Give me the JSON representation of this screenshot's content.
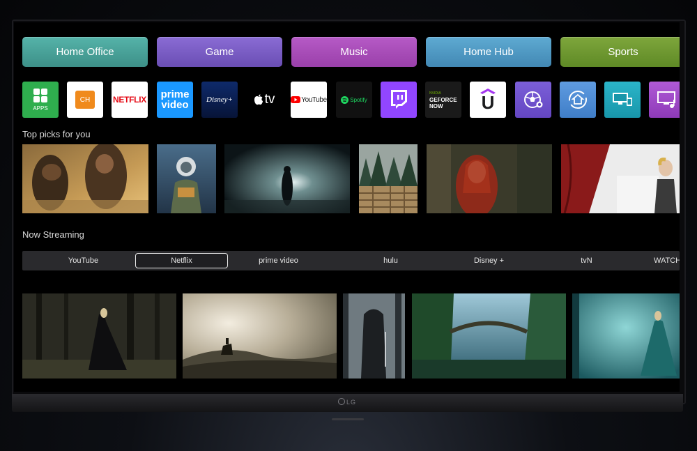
{
  "categories": [
    {
      "label": "Home Office",
      "color": "#4aa39a"
    },
    {
      "label": "Game",
      "color": "#7a5cc4"
    },
    {
      "label": "Music",
      "color": "#a84cb8"
    },
    {
      "label": "Home Hub",
      "color": "#4f9cc4"
    },
    {
      "label": "Sports",
      "color": "#6f9a2e"
    }
  ],
  "apps": [
    {
      "name": "apps",
      "label": "APPS"
    },
    {
      "name": "lg-channels",
      "label": "CH"
    },
    {
      "name": "netflix",
      "label": "NETFLIX"
    },
    {
      "name": "prime-video",
      "label_top": "prime",
      "label_bottom": "video"
    },
    {
      "name": "disney-plus",
      "label": "Disney+"
    },
    {
      "name": "apple-tv",
      "label": "tv"
    },
    {
      "name": "youtube",
      "label": "YouTube"
    },
    {
      "name": "spotify",
      "label": "Spotify"
    },
    {
      "name": "twitch",
      "label": ""
    },
    {
      "name": "geforce-now",
      "label_top": "NVIDIA",
      "label_mid": "GEFORCE",
      "label_bottom": "NOW"
    },
    {
      "name": "udemy",
      "label": "U"
    },
    {
      "name": "sports",
      "label": ""
    },
    {
      "name": "home-dashboard",
      "label": ""
    },
    {
      "name": "screen-share",
      "label": ""
    },
    {
      "name": "music-screen",
      "label": ""
    }
  ],
  "top_picks": {
    "title": "Top picks for you"
  },
  "now_streaming": {
    "title": "Now Streaming",
    "tabs": [
      "YouTube",
      "Netflix",
      "prime video",
      "hulu",
      "Disney +",
      "tvN",
      "WATCHA"
    ],
    "selected": "Netflix"
  },
  "tv": {
    "brand": "LG"
  }
}
